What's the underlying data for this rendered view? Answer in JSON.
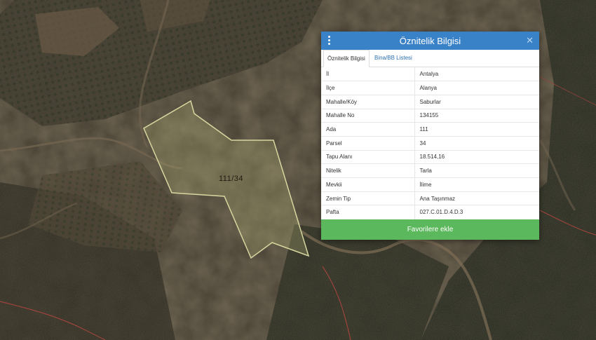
{
  "map": {
    "parcel_label": "111/34"
  },
  "panel": {
    "title": "Öznitelik Bilgisi",
    "menu_icon": "kebab-menu-icon",
    "close_icon": "close-icon",
    "close_glyph": "✕",
    "tabs": [
      {
        "label": "Öznitelik Bilgisi",
        "active": true
      },
      {
        "label": "Bina/BB Listesi",
        "active": false
      }
    ],
    "rows": [
      {
        "key": "İl",
        "value": "Antalya"
      },
      {
        "key": "İlçe",
        "value": "Alanya"
      },
      {
        "key": "Mahalle/Köy",
        "value": "Saburlar"
      },
      {
        "key": "Mahalle No",
        "value": "134155"
      },
      {
        "key": "Ada",
        "value": "111"
      },
      {
        "key": "Parsel",
        "value": "34"
      },
      {
        "key": "Tapu Alanı",
        "value": "18.514,16"
      },
      {
        "key": "Nitelik",
        "value": "Tarla"
      },
      {
        "key": "Mevkii",
        "value": "İlime"
      },
      {
        "key": "Zemin Tip",
        "value": "Ana Taşınmaz"
      },
      {
        "key": "Pafta",
        "value": "027.C.01.D.4.D.3"
      }
    ],
    "favorite_button": "Favorilere ekle"
  },
  "colors": {
    "header": "#3a82c8",
    "button": "#5cb85c",
    "parcel_outline": "#d8d7a0"
  }
}
